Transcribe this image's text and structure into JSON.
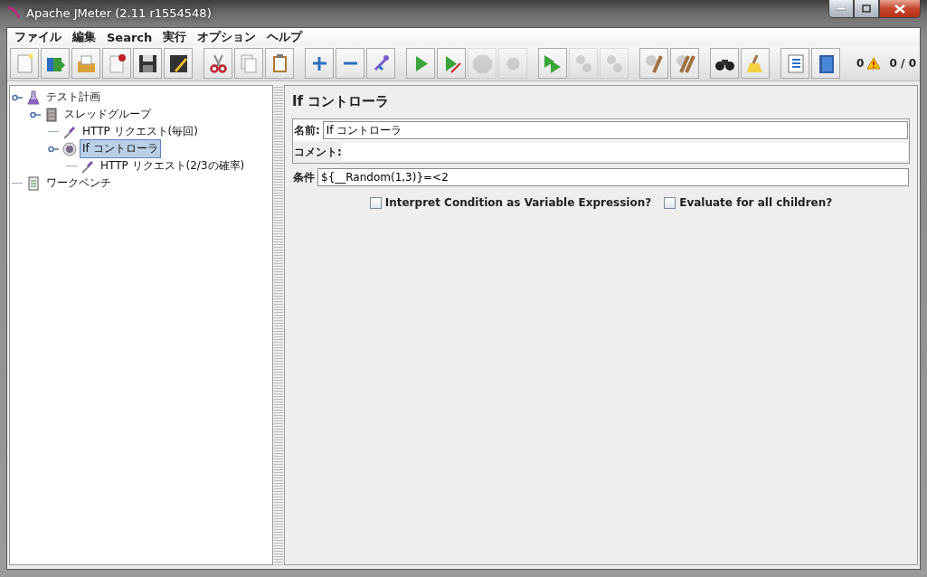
{
  "window": {
    "title": "Apache JMeter (2.11 r1554548)"
  },
  "menu": [
    "ファイル",
    "編集",
    "Search",
    "実行",
    "オプション",
    "ヘルプ"
  ],
  "toolbar": [
    [
      {
        "disabled": false
      },
      {
        "disabled": false
      },
      {
        "disabled": false
      },
      {
        "disabled": false
      },
      {
        "disabled": false
      },
      {
        "disabled": false
      }
    ],
    [
      {
        "disabled": false
      },
      {
        "disabled": false
      },
      {
        "disabled": false
      }
    ],
    [
      {
        "disabled": false
      },
      {
        "disabled": false
      },
      {
        "disabled": false
      }
    ],
    [
      {
        "disabled": false
      },
      {
        "disabled": false
      },
      {
        "disabled": true
      },
      {
        "disabled": true
      }
    ],
    [
      {
        "disabled": false
      },
      {
        "disabled": true
      },
      {
        "disabled": true
      }
    ],
    [
      {
        "disabled": false
      },
      {
        "disabled": false
      }
    ],
    [
      {
        "disabled": false
      },
      {
        "disabled": false
      }
    ],
    [
      {
        "disabled": false
      },
      {
        "disabled": false
      }
    ]
  ],
  "status": {
    "warnings": "0",
    "threads": "0 / 0"
  },
  "tree": [
    {
      "label": "テスト計画",
      "kind": "plan",
      "selected": false,
      "expanded": true,
      "children": [
        {
          "label": "スレッドグループ",
          "kind": "threads",
          "selected": false,
          "expanded": true,
          "children": [
            {
              "label": "HTTP リクエスト(毎回)",
              "kind": "sampler",
              "selected": false
            },
            {
              "label": "If コントローラ",
              "kind": "controller",
              "selected": true,
              "expanded": true,
              "children": [
                {
                  "label": "HTTP リクエスト(2/3の確率)",
                  "kind": "sampler",
                  "selected": false
                }
              ]
            }
          ]
        }
      ]
    },
    {
      "label": "ワークベンチ",
      "kind": "workbench",
      "selected": false
    }
  ],
  "panel": {
    "title": "If コントローラ",
    "name_label": "名前:",
    "name_value": "If コントローラ",
    "comment_label": "コメント:",
    "condition_label": "条件",
    "condition_value": "${__Random(1,3)}=<2",
    "options": [
      {
        "label": "Interpret Condition as Variable Expression?",
        "checked": false
      },
      {
        "label": "Evaluate for all children?",
        "checked": false
      }
    ]
  }
}
